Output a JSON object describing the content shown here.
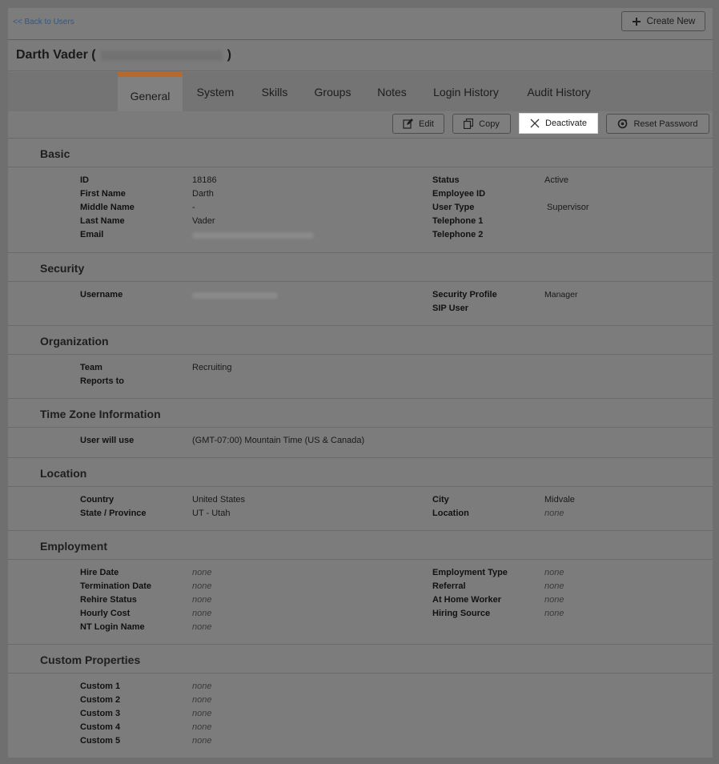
{
  "nav": {
    "back_label": "<< Back to Users",
    "create_label": "Create New"
  },
  "user": {
    "name_prefix": "Darth Vader (",
    "name_suffix": ")"
  },
  "tabs": [
    {
      "label": "General",
      "active": true
    },
    {
      "label": "System"
    },
    {
      "label": "Skills"
    },
    {
      "label": "Groups"
    },
    {
      "label": "Notes"
    },
    {
      "label": "Login History"
    },
    {
      "label": "Audit History"
    }
  ],
  "actions": {
    "edit": "Edit",
    "copy": "Copy",
    "deactivate": "Deactivate",
    "reset": "Reset Password"
  },
  "basic": {
    "title": "Basic",
    "id_label": "ID",
    "id_value": "18186",
    "first_label": "First Name",
    "first_value": "Darth",
    "middle_label": "Middle Name",
    "middle_value": "-",
    "last_label": "Last Name",
    "last_value": "Vader",
    "email_label": "Email",
    "status_label": "Status",
    "status_value": "Active",
    "empid_label": "Employee ID",
    "type_label": "User Type",
    "type_value": "Supervisor",
    "tel1_label": "Telephone 1",
    "tel2_label": "Telephone 2"
  },
  "security": {
    "title": "Security",
    "username_label": "Username",
    "profile_label": "Security Profile",
    "profile_value": "Manager",
    "sip_label": "SIP User"
  },
  "organization": {
    "title": "Organization",
    "team_label": "Team",
    "team_value": "Recruiting",
    "reports_label": "Reports to"
  },
  "timezone": {
    "title": "Time Zone Information",
    "use_label": "User will use",
    "use_value": "(GMT-07:00) Mountain Time (US & Canada)"
  },
  "location": {
    "title": "Location",
    "country_label": "Country",
    "country_value": "United States",
    "state_label": "State / Province",
    "state_value": "UT - Utah",
    "city_label": "City",
    "city_value": "Midvale",
    "location_label": "Location",
    "location_value": "none"
  },
  "employment": {
    "title": "Employment",
    "hire_label": "Hire Date",
    "hire_value": "none",
    "term_label": "Termination Date",
    "term_value": "none",
    "rehire_label": "Rehire Status",
    "rehire_value": "none",
    "hourly_label": "Hourly Cost",
    "hourly_value": "none",
    "nt_label": "NT Login Name",
    "nt_value": "none",
    "etype_label": "Employment Type",
    "etype_value": "none",
    "referral_label": "Referral",
    "referral_value": "none",
    "home_label": "At Home Worker",
    "home_value": "none",
    "source_label": "Hiring Source",
    "source_value": "none"
  },
  "custom": {
    "title": "Custom Properties",
    "c1_label": "Custom 1",
    "c1_value": "none",
    "c2_label": "Custom 2",
    "c2_value": "none",
    "c3_label": "Custom 3",
    "c3_value": "none",
    "c4_label": "Custom 4",
    "c4_value": "none",
    "c5_label": "Custom 5",
    "c5_value": "none"
  },
  "icons": {
    "create": "plus-icon",
    "edit": "edit-icon",
    "copy": "copy-icon",
    "deactivate": "close-icon",
    "reset": "reset-icon"
  },
  "colors": {
    "active_tab_accent": "#b7682c",
    "overlay_gray": "#7c7c7c",
    "link": "#2c5a8a"
  }
}
